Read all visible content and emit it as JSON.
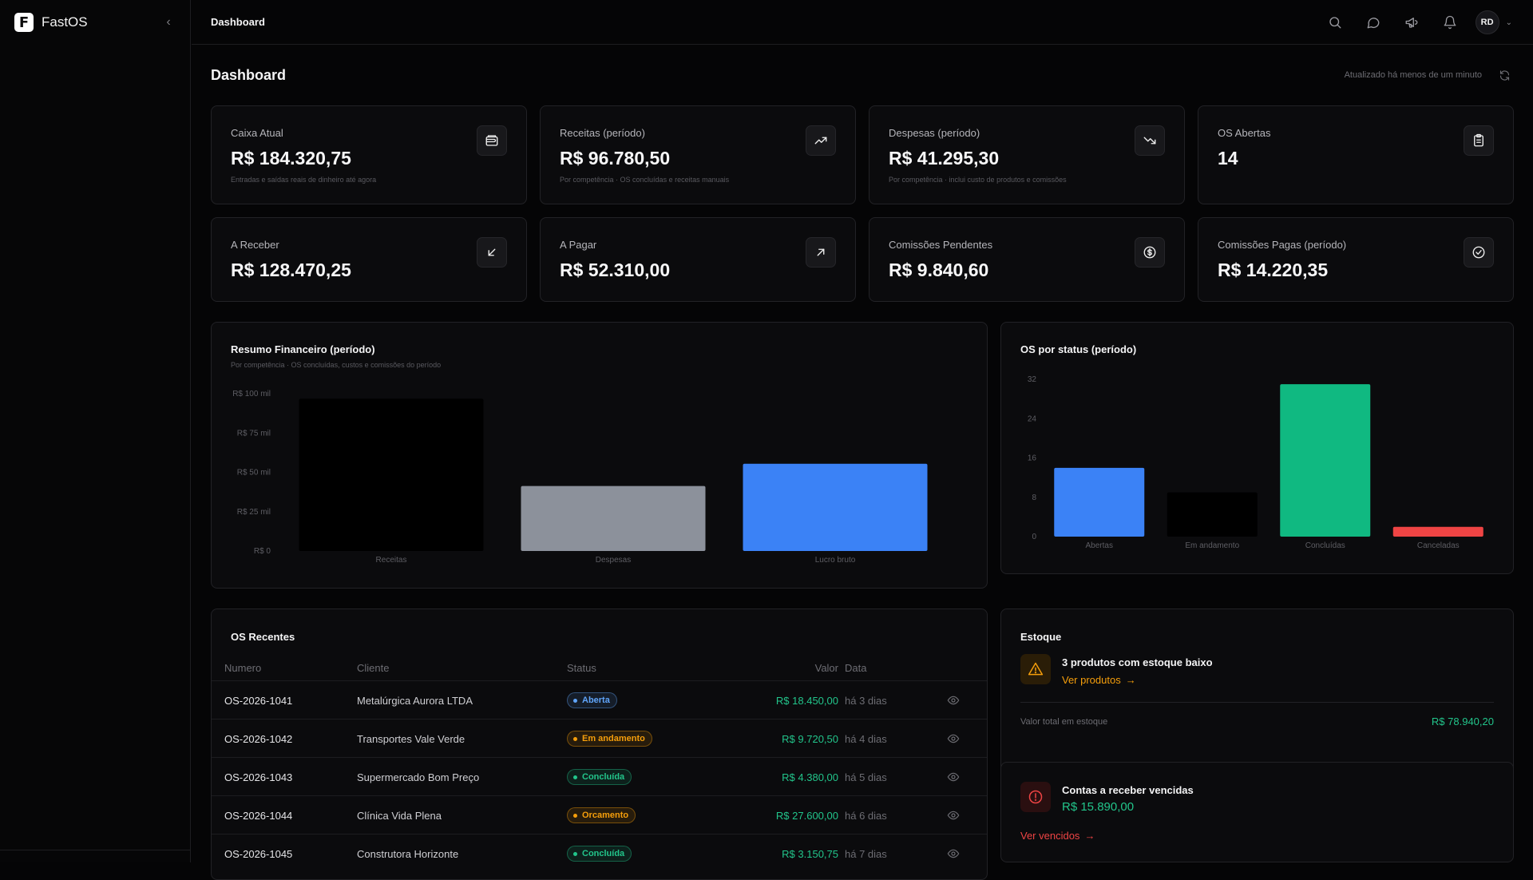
{
  "app": {
    "name": "FastOS",
    "logo_letter": "F"
  },
  "topbar": {
    "breadcrumb": "Dashboard",
    "avatar_initials": "RD",
    "icons": [
      "search-icon",
      "chat-icon",
      "megaphone-icon",
      "bell-icon"
    ]
  },
  "page": {
    "title": "Dashboard",
    "updated": "Atualizado há menos de um minuto"
  },
  "stats": [
    {
      "label": "Caixa Atual",
      "value": "R$ 184.320,75",
      "sub": "Entradas e saídas reais de dinheiro até agora",
      "icon": "wallet-icon"
    },
    {
      "label": "Receitas (período)",
      "value": "R$ 96.780,50",
      "sub": "Por competência · OS concluídas e receitas manuais",
      "icon": "trending-up-icon"
    },
    {
      "label": "Despesas (período)",
      "value": "R$ 41.295,30",
      "sub": "Por competência · inclui custo de produtos e comissões",
      "icon": "trending-down-icon"
    },
    {
      "label": "OS Abertas",
      "value": "14",
      "sub": "",
      "icon": "clipboard-icon"
    },
    {
      "label": "A Receber",
      "value": "R$ 128.470,25",
      "sub": "",
      "icon": "arrow-down-left-icon"
    },
    {
      "label": "A Pagar",
      "value": "R$ 52.310,00",
      "sub": "",
      "icon": "arrow-up-right-icon"
    },
    {
      "label": "Comissões Pendentes",
      "value": "R$ 9.840,60",
      "sub": "",
      "icon": "dollar-circle-icon"
    },
    {
      "label": "Comissões Pagas (período)",
      "value": "R$ 14.220,35",
      "sub": "",
      "icon": "check-circle-icon"
    }
  ],
  "finance_chart": {
    "title": "Resumo Financeiro (período)",
    "subtitle": "Por competência · OS concluídas, custos e comissões do período"
  },
  "status_chart": {
    "title": "OS por status (período)"
  },
  "chart_data": [
    {
      "type": "bar",
      "title": "Resumo Financeiro (período)",
      "categories": [
        "Receitas",
        "Despesas",
        "Lucro bruto"
      ],
      "values": [
        96780.5,
        41295.3,
        55485.2
      ],
      "colors": [
        "#000000",
        "#8c919b",
        "#3b82f6"
      ],
      "ylim": [
        0,
        100000
      ],
      "yticks": [
        0,
        25000,
        50000,
        75000,
        100000
      ],
      "ytick_labels": [
        "R$ 0",
        "R$ 25 mil",
        "R$ 50 mil",
        "R$ 75 mil",
        "R$ 100 mil"
      ],
      "grid": false
    },
    {
      "type": "bar",
      "title": "OS por status (período)",
      "categories": [
        "Abertas",
        "Em andamento",
        "Concluídas",
        "Canceladas"
      ],
      "values": [
        14,
        9,
        31,
        2
      ],
      "colors": [
        "#3b82f6",
        "#000000",
        "#10b981",
        "#ef4444"
      ],
      "ylim": [
        0,
        32
      ],
      "yticks": [
        0,
        8,
        16,
        24,
        32
      ],
      "ytick_labels": [
        "0",
        "8",
        "16",
        "24",
        "32"
      ],
      "grid": false
    }
  ],
  "recent": {
    "title": "OS Recentes",
    "columns": {
      "numero": "Numero",
      "cliente": "Cliente",
      "status": "Status",
      "valor": "Valor",
      "data": "Data"
    },
    "rows": [
      {
        "numero": "OS-2026-1041",
        "cliente": "Metalúrgica Aurora LTDA",
        "status": "Aberta",
        "status_color": "#60a5fa",
        "valor": "R$ 18.450,00",
        "data": "há 3 dias"
      },
      {
        "numero": "OS-2026-1042",
        "cliente": "Transportes Vale Verde",
        "status": "Em andamento",
        "status_color": "#f59e0b",
        "valor": "R$ 9.720,50",
        "data": "há 4 dias"
      },
      {
        "numero": "OS-2026-1043",
        "cliente": "Supermercado Bom Preço",
        "status": "Concluída",
        "status_color": "#22c58b",
        "valor": "R$ 4.380,00",
        "data": "há 5 dias"
      },
      {
        "numero": "OS-2026-1044",
        "cliente": "Clínica Vida Plena",
        "status": "Orcamento",
        "status_color": "#f59e0b",
        "valor": "R$ 27.600,00",
        "data": "há 6 dias"
      },
      {
        "numero": "OS-2026-1045",
        "cliente": "Construtora Horizonte",
        "status": "Concluída",
        "status_color": "#22c58b",
        "valor": "R$ 3.150,75",
        "data": "há 7 dias"
      }
    ]
  },
  "stock": {
    "title": "Estoque",
    "alert": "3 produtos com estoque baixo",
    "link": "Ver produtos",
    "total_label": "Valor total em estoque",
    "total_value": "R$ 78.940,20"
  },
  "overdue": {
    "title": "Contas a receber vencidas",
    "value": "R$ 15.890,00",
    "link": "Ver vencidos"
  },
  "colors": {
    "accent_orange": "#f59e0b",
    "accent_green": "#22c58b",
    "accent_red": "#ef4444",
    "accent_blue": "#3b82f6"
  }
}
